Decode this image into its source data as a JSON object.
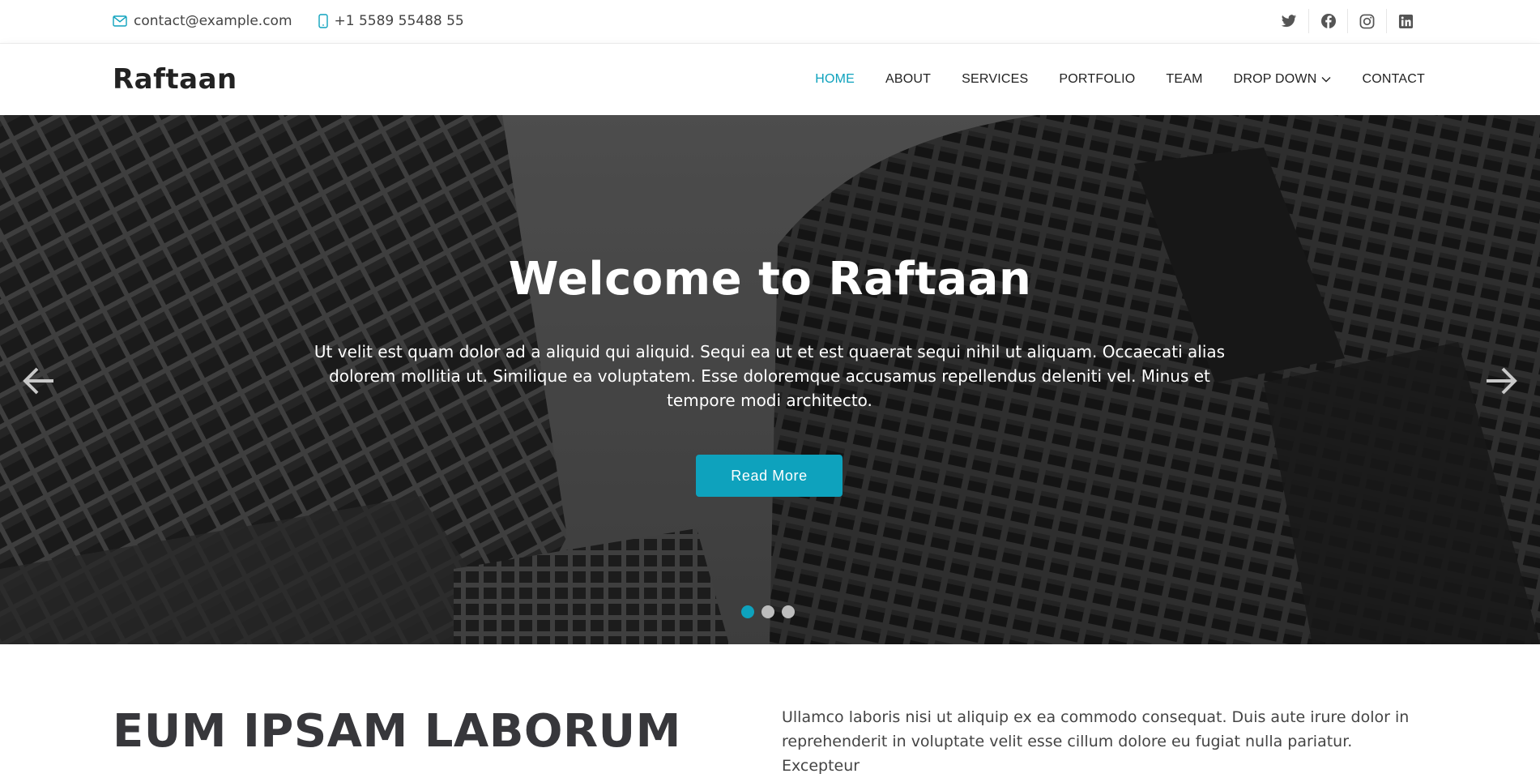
{
  "topbar": {
    "email": "contact@example.com",
    "phone": "+1 5589 55488 55",
    "social": [
      {
        "icon": "twitter-icon"
      },
      {
        "icon": "facebook-icon"
      },
      {
        "icon": "instagram-icon"
      },
      {
        "icon": "linkedin-icon"
      }
    ]
  },
  "header": {
    "logo": "Raftaan",
    "nav": [
      {
        "label": "HOME",
        "active": true
      },
      {
        "label": "ABOUT"
      },
      {
        "label": "SERVICES"
      },
      {
        "label": "PORTFOLIO"
      },
      {
        "label": "TEAM"
      },
      {
        "label": "DROP DOWN",
        "has_dropdown": true
      },
      {
        "label": "CONTACT"
      }
    ]
  },
  "hero": {
    "title": "Welcome to Raftaan",
    "text": "Ut velit est quam dolor ad a aliquid qui aliquid. Sequi ea ut et est quaerat sequi nihil ut aliquam. Occaecati alias dolorem mollitia ut. Similique ea voluptatem. Esse doloremque accusamus repellendus deleniti vel. Minus et tempore modi architecto.",
    "button": "Read More",
    "slide_count": 3,
    "active_slide": 1
  },
  "about": {
    "title": "EUM IPSAM LABORUM",
    "text": "Ullamco laboris nisi ut aliquip ex ea commodo consequat. Duis aute irure dolor in reprehenderit in voluptate velit esse cillum dolore eu fugiat nulla pariatur. Excepteur"
  },
  "colors": {
    "accent": "#0ea2bd",
    "text_dark": "#222222"
  }
}
